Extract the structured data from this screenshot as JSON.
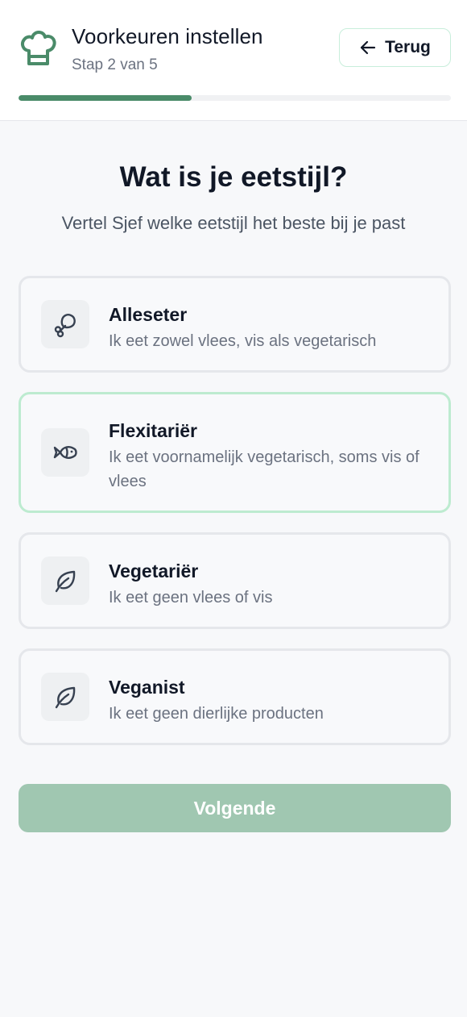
{
  "header": {
    "title": "Voorkeuren instellen",
    "step_label": "Stap 2 van 5",
    "back_label": "Terug",
    "logo_icon": "chef-hat-icon",
    "progress": {
      "current_step": 2,
      "total_steps": 5,
      "fraction": 0.4
    }
  },
  "question": {
    "heading": "Wat is je eetstijl?",
    "subheading": "Vertel Sjef welke eetstijl het beste bij je past"
  },
  "options": [
    {
      "title": "Alleseter",
      "description": "Ik eet zowel vlees, vis als vegetarisch",
      "icon": "drumstick-icon",
      "selected": false
    },
    {
      "title": "Flexitariër",
      "description": "Ik eet voornamelijk vegetarisch, soms vis of vlees",
      "icon": "fish-icon",
      "selected": true
    },
    {
      "title": "Vegetariër",
      "description": "Ik eet geen vlees of vis",
      "icon": "leaf-icon",
      "selected": false
    },
    {
      "title": "Veganist",
      "description": "Ik eet geen dierlijke producten",
      "icon": "leaf-icon",
      "selected": false
    }
  ],
  "next_button": {
    "label": "Volgende",
    "enabled": false
  },
  "colors": {
    "accent": "#4a8b69",
    "selected_border": "#bdebd0",
    "next_disabled": "#a0c7b1"
  }
}
